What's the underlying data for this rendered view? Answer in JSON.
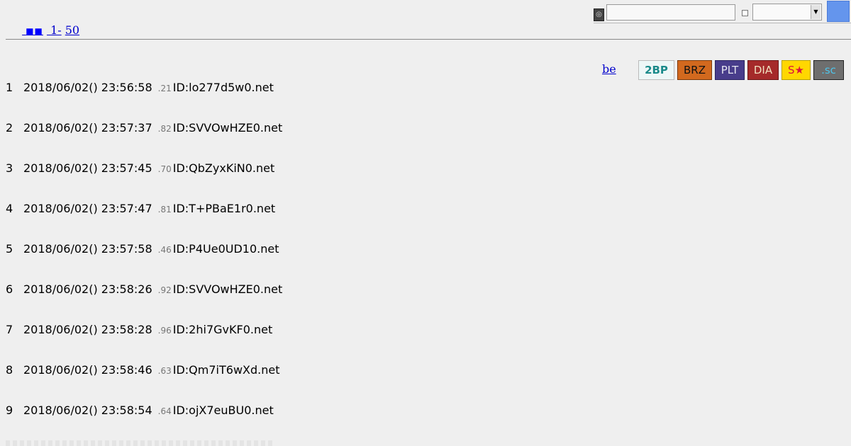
{
  "search": {
    "input_value": "",
    "select_value": "",
    "icon": "search-target-icon"
  },
  "nav": {
    "blank_link": "",
    "blocks_link": "■■",
    "range_start": "1-",
    "range_end": "50"
  },
  "header_links": {
    "be": "be"
  },
  "badges": [
    {
      "label": "2BP",
      "color": "#1a8a8a"
    },
    {
      "label": "BRZ",
      "color": "#d2691e"
    },
    {
      "label": "PLT",
      "color": "#483d8b"
    },
    {
      "label": "DIA",
      "color": "#a52a2a"
    },
    {
      "label": "S★",
      "color": "#ffd700"
    },
    {
      "label": ".sc",
      "color": "#6e6e6e"
    }
  ],
  "posts": [
    {
      "num": "1",
      "date": "2018/06/02() 23:56:58",
      "ip": ".21",
      "id": "ID:lo277d5w0.net"
    },
    {
      "num": "2",
      "date": "2018/06/02() 23:57:37",
      "ip": ".82",
      "id": "ID:SVVOwHZE0.net"
    },
    {
      "num": "3",
      "date": "2018/06/02() 23:57:45",
      "ip": ".70",
      "id": "ID:QbZyxKiN0.net"
    },
    {
      "num": "4",
      "date": "2018/06/02() 23:57:47",
      "ip": ".81",
      "id": "ID:T+PBaE1r0.net"
    },
    {
      "num": "5",
      "date": "2018/06/02() 23:57:58",
      "ip": ".46",
      "id": "ID:P4Ue0UD10.net"
    },
    {
      "num": "6",
      "date": "2018/06/02() 23:58:26",
      "ip": ".92",
      "id": "ID:SVVOwHZE0.net"
    },
    {
      "num": "7",
      "date": "2018/06/02() 23:58:28",
      "ip": ".96",
      "id": "ID:2hi7GvKF0.net"
    },
    {
      "num": "8",
      "date": "2018/06/02() 23:58:46",
      "ip": ".63",
      "id": "ID:Qm7iT6wXd.net"
    },
    {
      "num": "9",
      "date": "2018/06/02() 23:58:54",
      "ip": ".64",
      "id": "ID:ojX7euBU0.net"
    }
  ]
}
